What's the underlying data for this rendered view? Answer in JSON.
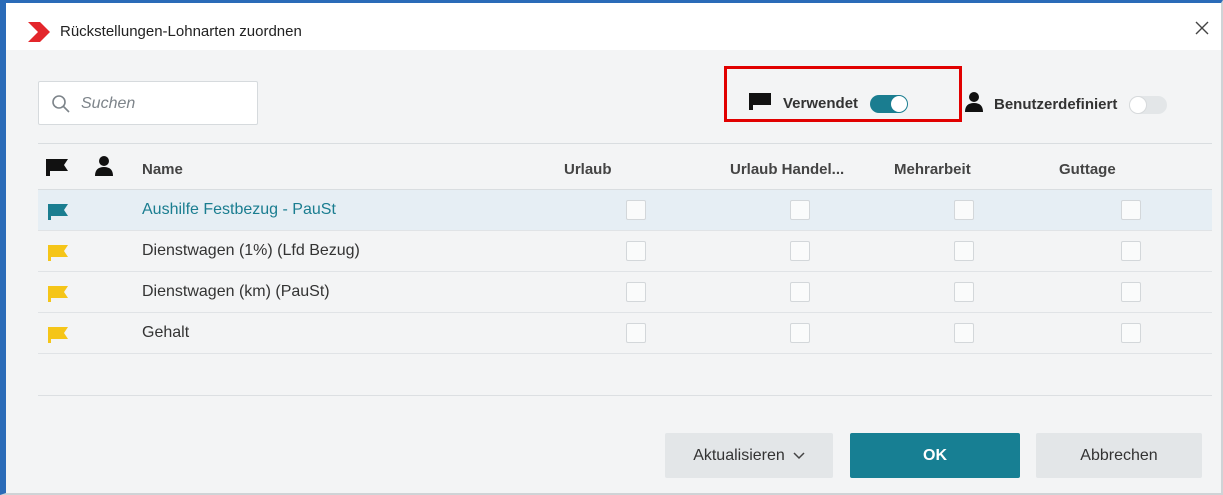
{
  "window": {
    "title": "Rückstellungen-Lohnarten zuordnen"
  },
  "search": {
    "placeholder": "Suchen"
  },
  "filters": {
    "used": {
      "label": "Verwendet",
      "on": true
    },
    "custom": {
      "label": "Benutzerdefiniert",
      "on": false
    }
  },
  "table": {
    "columns": [
      "Name",
      "Urlaub",
      "Urlaub Handel...",
      "Mehrarbeit",
      "Guttage"
    ],
    "rows": [
      {
        "name": "Aushilfe Festbezug - PauSt",
        "flag_color": "#1a7d90",
        "selected": true,
        "checks": [
          false,
          false,
          false,
          false
        ]
      },
      {
        "name": "Dienstwagen (1%) (Lfd Bezug)",
        "flag_color": "#f5c518",
        "selected": false,
        "checks": [
          false,
          false,
          false,
          false
        ]
      },
      {
        "name": "Dienstwagen (km) (PauSt)",
        "flag_color": "#f5c518",
        "selected": false,
        "checks": [
          false,
          false,
          false,
          false
        ]
      },
      {
        "name": "Gehalt",
        "flag_color": "#f5c518",
        "selected": false,
        "checks": [
          false,
          false,
          false,
          false
        ]
      }
    ]
  },
  "buttons": {
    "update": "Aktualisieren",
    "ok": "OK",
    "cancel": "Abbrechen"
  },
  "colors": {
    "accent": "#1a7d90",
    "brand": "#e3262b",
    "used_flag": "#f5c518",
    "highlight": "#e10000"
  },
  "icons": {
    "title": "logo-chevron-icon",
    "close": "close-icon",
    "search": "search-icon",
    "used": "flag-icon",
    "custom": "person-icon",
    "dropdown": "chevron-down-icon"
  }
}
